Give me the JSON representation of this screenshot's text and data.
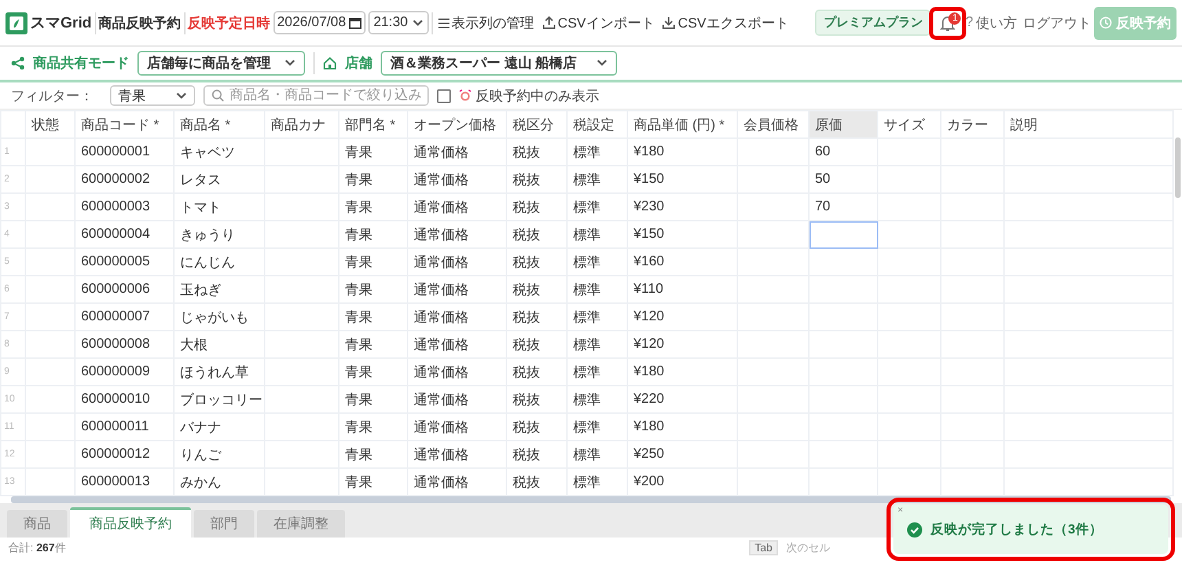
{
  "app": {
    "brand": "スマGrid",
    "page_title": "商品反映予約",
    "schedule_label": "反映予定日時",
    "date": "2026/07/08",
    "time": "21:30",
    "actions": [
      {
        "kind": "columns",
        "label": "表示列の管理"
      },
      {
        "kind": "import",
        "label": "CSVインポート"
      },
      {
        "kind": "export",
        "label": "CSVエクスポート"
      }
    ],
    "plan_badge": "プレミアムプラン",
    "notifications": {
      "count": "1",
      "highlighted": true
    },
    "help_icon": "?",
    "help": "使い方",
    "logout": "ログアウト",
    "reserve_button": {
      "label": "反映予約",
      "disabled": true
    }
  },
  "mode_bar": {
    "mode_label": "商品共有モード",
    "mode_value": "店舗毎に商品を管理",
    "store_label": "店舗",
    "store_value": "酒＆業務スーパー 遠山 船橋店"
  },
  "filter_bar": {
    "label": "フィルター：",
    "category": "青果",
    "search": {
      "placeholder": "商品名・商品コードで絞り込み"
    },
    "only_scheduled": {
      "label": "反映予約中のみ表示",
      "checked": false
    }
  },
  "table": {
    "columns": [
      {
        "label": "状態",
        "selected": false
      },
      {
        "label": "商品コード *",
        "selected": false
      },
      {
        "label": "商品名 *",
        "selected": false
      },
      {
        "label": "商品カナ",
        "selected": false
      },
      {
        "label": "部門名 *",
        "selected": false
      },
      {
        "label": "オープン価格",
        "selected": false
      },
      {
        "label": "税区分",
        "selected": false
      },
      {
        "label": "税設定",
        "selected": false
      },
      {
        "label": "商品単価 (円) *",
        "selected": false
      },
      {
        "label": "会員価格",
        "selected": false
      },
      {
        "label": "原価",
        "selected": true
      },
      {
        "label": "サイズ",
        "selected": false
      },
      {
        "label": "カラー",
        "selected": false
      },
      {
        "label": "説明",
        "selected": false
      }
    ],
    "rows": [
      {
        "number": "1",
        "cells": [
          null,
          "600000001",
          "キャベツ",
          null,
          "青果",
          "通常価格",
          "税抜",
          "標準",
          "¥180",
          null,
          "60",
          null,
          null,
          null
        ]
      },
      {
        "number": "2",
        "cells": [
          null,
          "600000002",
          "レタス",
          null,
          "青果",
          "通常価格",
          "税抜",
          "標準",
          "¥150",
          null,
          "50",
          null,
          null,
          null
        ]
      },
      {
        "number": "3",
        "cells": [
          null,
          "600000003",
          "トマト",
          null,
          "青果",
          "通常価格",
          "税抜",
          "標準",
          "¥230",
          null,
          "70",
          null,
          null,
          null
        ]
      },
      {
        "number": "4",
        "cells": [
          null,
          "600000004",
          "きゅうり",
          null,
          "青果",
          "通常価格",
          "税抜",
          "標準",
          "¥150",
          null,
          {
            "selected": true
          },
          null,
          null,
          null
        ]
      },
      {
        "number": "5",
        "cells": [
          null,
          "600000005",
          "にんじん",
          null,
          "青果",
          "通常価格",
          "税抜",
          "標準",
          "¥160",
          null,
          null,
          null,
          null,
          null
        ]
      },
      {
        "number": "6",
        "cells": [
          null,
          "600000006",
          "玉ねぎ",
          null,
          "青果",
          "通常価格",
          "税抜",
          "標準",
          "¥110",
          null,
          null,
          null,
          null,
          null
        ]
      },
      {
        "number": "7",
        "cells": [
          null,
          "600000007",
          "じゃがいも",
          null,
          "青果",
          "通常価格",
          "税抜",
          "標準",
          "¥120",
          null,
          null,
          null,
          null,
          null
        ]
      },
      {
        "number": "8",
        "cells": [
          null,
          "600000008",
          "大根",
          null,
          "青果",
          "通常価格",
          "税抜",
          "標準",
          "¥120",
          null,
          null,
          null,
          null,
          null
        ]
      },
      {
        "number": "9",
        "cells": [
          null,
          "600000009",
          "ほうれん草",
          null,
          "青果",
          "通常価格",
          "税抜",
          "標準",
          "¥180",
          null,
          null,
          null,
          null,
          null
        ]
      },
      {
        "number": "10",
        "cells": [
          null,
          "600000010",
          "ブロッコリー",
          null,
          "青果",
          "通常価格",
          "税抜",
          "標準",
          "¥220",
          null,
          null,
          null,
          null,
          null
        ]
      },
      {
        "number": "11",
        "cells": [
          null,
          "600000011",
          "バナナ",
          null,
          "青果",
          "通常価格",
          "税抜",
          "標準",
          "¥180",
          null,
          null,
          null,
          null,
          null
        ]
      },
      {
        "number": "12",
        "cells": [
          null,
          "600000012",
          "りんご",
          null,
          "青果",
          "通常価格",
          "税抜",
          "標準",
          "¥250",
          null,
          null,
          null,
          null,
          null
        ]
      },
      {
        "number": "13",
        "cells": [
          null,
          "600000013",
          "みかん",
          null,
          "青果",
          "通常価格",
          "税抜",
          "標準",
          "¥200",
          null,
          null,
          null,
          null,
          null
        ]
      }
    ]
  },
  "sheet_tabs": [
    {
      "label": "商品",
      "selected": false
    },
    {
      "label": "商品反映予約",
      "selected": true
    },
    {
      "label": "部門",
      "selected": false
    },
    {
      "label": "在庫調整",
      "selected": false
    }
  ],
  "footer": {
    "total": "合計: **267**件",
    "key": "Tab",
    "key_hint": "次のセル"
  },
  "toast": {
    "close": "×",
    "message": "反映が完了しました（3件）",
    "highlighted": true
  }
}
